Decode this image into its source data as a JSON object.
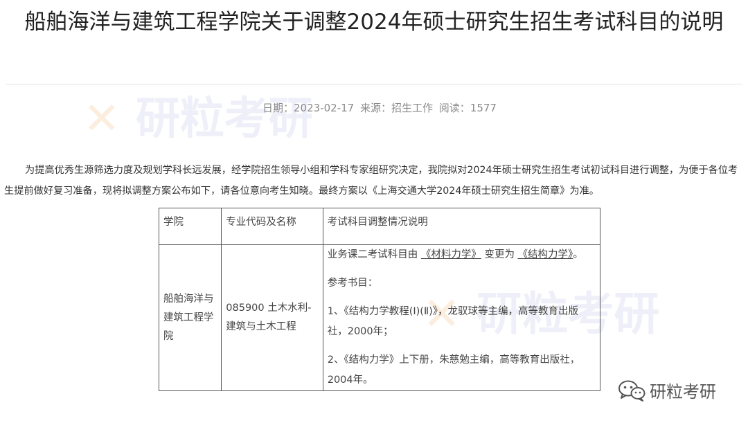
{
  "article": {
    "title": "船舶海洋与建筑工程学院关于调整2024年硕士研究生招生考试科目的说明",
    "meta": {
      "date": "日期：2023-02-17",
      "source": "来源：招生工作",
      "views": "阅读：1577"
    },
    "intro": "为提高优秀生源筛选力度及规划学科长远发展，经学院招生领导小组和学科专家组研究决定，我院拟对2024年硕士研究生招生考试初试科目进行调整，为便于各位考生提前做好复习准备，现将拟调整方案公布如下，请各位意向考生知晓。最终方案以《上海交通大学2024年硕士研究生招生简章》为准。"
  },
  "table": {
    "headers": [
      "学院",
      "专业代码及名称",
      "考试科目调整情况说明"
    ],
    "row": {
      "school": "船舶海洋与建筑工程学院",
      "major": "085900 土木水利-建筑与土木工程",
      "change_prefix": "业务课二考试科目由",
      "change_old": "《材料力学》",
      "change_mid": "变更为",
      "change_new": "《结构力学》",
      "change_suffix": "。",
      "ref_heading": "参考书目：",
      "ref1": "1、《结构力学教程(Ⅰ)(Ⅱ)》，龙驭球等主编，高等教育出版社，2000年；",
      "ref2": "2、《结构力学》上下册，朱慈勉主编，高等教育出版社，2004年。"
    }
  },
  "watermark": {
    "text": "研粒考研"
  },
  "brand": {
    "label": "研粒考研",
    "icon": "wechat-icon"
  }
}
